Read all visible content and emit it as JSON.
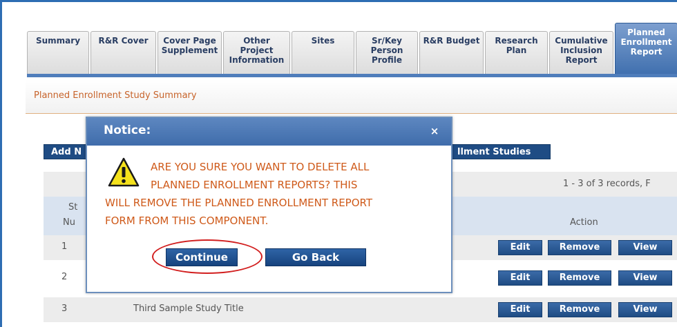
{
  "tabs": [
    {
      "label": "Summary",
      "active": false
    },
    {
      "label": "R&R Cover",
      "active": false
    },
    {
      "label": "Cover Page\nSupplement",
      "active": false
    },
    {
      "label": "Other\nProject\nInformation",
      "active": false
    },
    {
      "label": "Sites",
      "active": false
    },
    {
      "label": "Sr/Key\nPerson\nProfile",
      "active": false
    },
    {
      "label": "R&R Budget",
      "active": false
    },
    {
      "label": "Research\nPlan",
      "active": false
    },
    {
      "label": "Cumulative\nInclusion\nReport",
      "active": false
    },
    {
      "label": "Planned\nEnrollment\nReport",
      "active": true
    }
  ],
  "section": {
    "title": "Planned Enrollment Study Summary"
  },
  "background": {
    "add_button_label": "Add N",
    "studies_button_label": "llment Studies",
    "records_text": "1 - 3 of 3 records, F",
    "col_study_label": "St",
    "col_num_label": "Nu",
    "col_action_label": "Action",
    "rows": [
      {
        "num": "1",
        "title": ""
      },
      {
        "num": "2",
        "title": ""
      },
      {
        "num": "3",
        "title": "Third Sample Study Title"
      }
    ],
    "row_actions": {
      "edit": "Edit",
      "remove": "Remove",
      "view": "View"
    }
  },
  "modal": {
    "title": "Notice:",
    "close_glyph": "×",
    "message_lines": [
      "ARE YOU SURE YOU WANT TO DELETE ALL",
      "PLANNED ENROLLMENT REPORTS? THIS",
      "WILL REMOVE THE PLANNED ENROLLMENT REPORT",
      "FORM FROM THIS COMPONENT."
    ],
    "continue_label": "Continue",
    "goback_label": "Go Back",
    "warning_icon": "warning-icon"
  },
  "colors": {
    "accent_blue": "#1f4c84",
    "warning_text": "#cf5a1a",
    "highlight_ring": "#d21f1f"
  }
}
